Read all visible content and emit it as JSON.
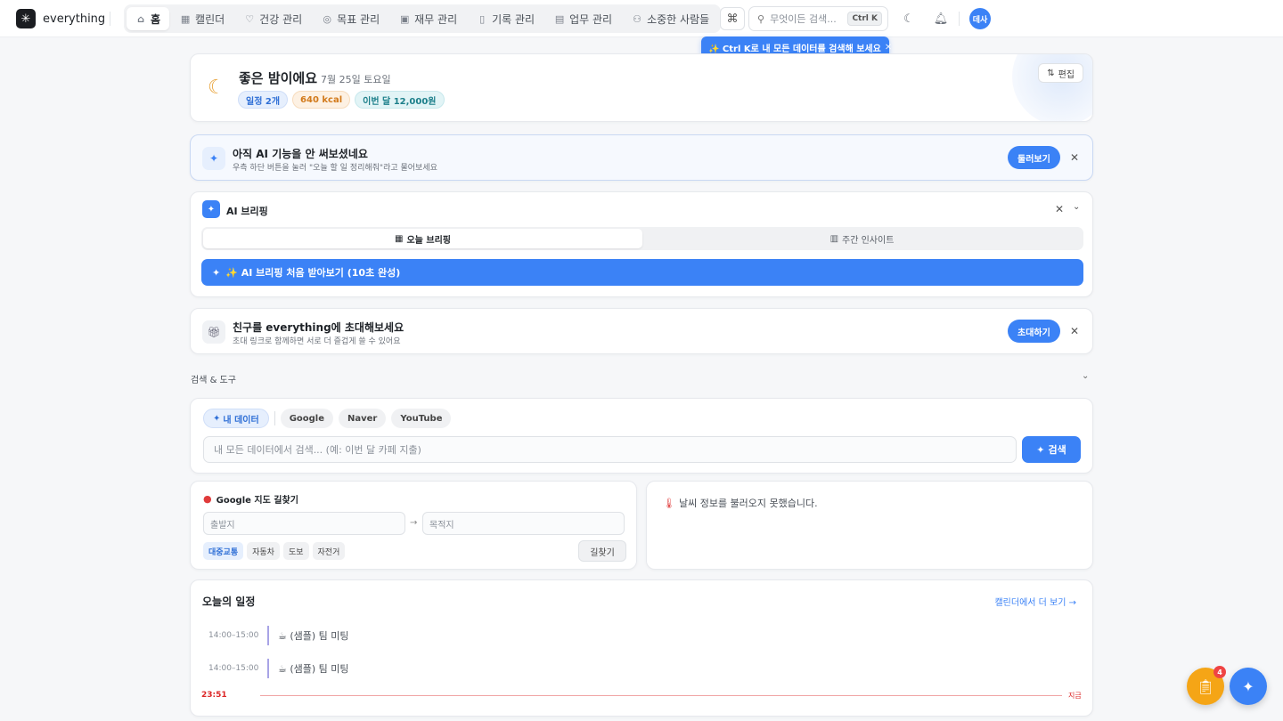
{
  "brand": {
    "name": "everything",
    "logo_icon": "asterisk-icon"
  },
  "nav": {
    "items": [
      {
        "label": "홈",
        "icon": "home-icon",
        "active": true
      },
      {
        "label": "캘린더",
        "icon": "calendar-icon"
      },
      {
        "label": "건강 관리",
        "icon": "heart-icon"
      },
      {
        "label": "목표 관리",
        "icon": "target-icon"
      },
      {
        "label": "재무 관리",
        "icon": "wallet-icon"
      },
      {
        "label": "기록 관리",
        "icon": "book-icon"
      },
      {
        "label": "업무 관리",
        "icon": "briefcase-icon"
      },
      {
        "label": "소중한 사람들",
        "icon": "users-icon"
      }
    ]
  },
  "topbar": {
    "search_placeholder": "무엇이든 검색...",
    "shortcut": "Ctrl K",
    "avatar": "데사",
    "tooltip": "✨ Ctrl K로 내 모든 데이터를 검색해 보세요"
  },
  "greeting": {
    "title": "좋은 밤이에요",
    "date": "7월 25일 토요일",
    "chips": [
      "일정 2개",
      "640 kcal",
      "이번 달 12,000원"
    ],
    "edit_label": "편집"
  },
  "ai_promo": {
    "title": "아직 AI 기능을 안 써보셨네요",
    "subtitle": "우측 하단 버튼을 눌러 \"오늘 할 일 정리해줘\"라고 물어보세요",
    "button": "둘러보기"
  },
  "briefing": {
    "title": "AI 브리핑",
    "tabs": [
      "오늘 브리핑",
      "주간 인사이트"
    ],
    "cta": "✨ AI 브리핑 처음 받아보기 (10초 완성)"
  },
  "invite": {
    "title": "친구를 everything에 초대해보세요",
    "subtitle": "초대 링크로 함께하면 서로 더 즐겁게 쓸 수 있어요",
    "button": "초대하기"
  },
  "tools_section": {
    "label": "검색 & 도구"
  },
  "search": {
    "tabs": [
      "내 데이터",
      "Google",
      "Naver",
      "YouTube"
    ],
    "placeholder": "내 모든 데이터에서 검색... (예: 이번 달 카페 지출)",
    "button": "검색"
  },
  "maps": {
    "title": "Google 지도 길찾기",
    "origin_placeholder": "출발지",
    "dest_placeholder": "목적지",
    "modes": [
      "대중교통",
      "자동차",
      "도보",
      "자전거"
    ],
    "button": "길찾기"
  },
  "weather": {
    "message": "날씨 정보를 불러오지 못했습니다."
  },
  "schedule": {
    "title": "오늘의 일정",
    "link": "캘린더에서 더 보기 →",
    "events": [
      {
        "time": "14:00–15:00",
        "title": "☕ (샘플) 팀 미팅"
      },
      {
        "time": "14:00–15:00",
        "title": "☕ (샘플) 팀 미팅"
      }
    ],
    "now_time": "23:51",
    "now_label": "지금"
  },
  "fab": {
    "badge": "4"
  },
  "colors": {
    "accent": "#3b82f6",
    "warning": "#f5a516",
    "danger": "#dc2626"
  }
}
